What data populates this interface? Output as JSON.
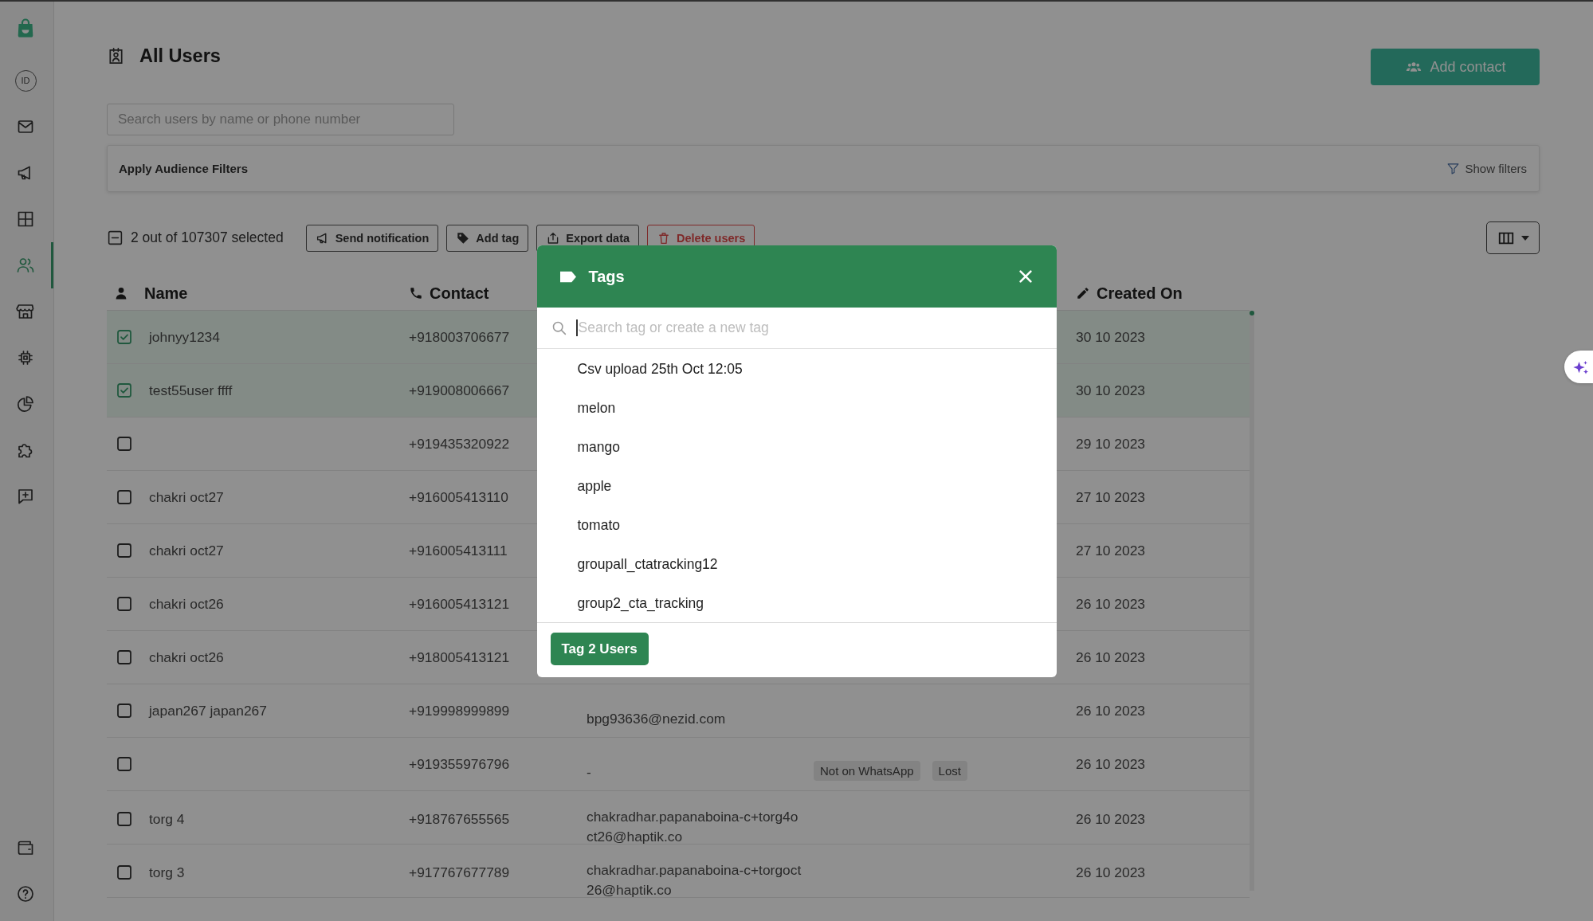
{
  "sidebar": {
    "items": [
      {
        "label": "ID",
        "selected": false
      },
      {
        "selected": false
      },
      {
        "selected": false
      },
      {
        "selected": false
      },
      {
        "selected": true
      },
      {
        "selected": false
      },
      {
        "selected": false
      },
      {
        "selected": false
      },
      {
        "selected": false
      },
      {
        "selected": false
      }
    ],
    "bottom_items": [
      {
        "selected": false
      },
      {
        "selected": false
      }
    ]
  },
  "header": {
    "title": "All Users",
    "add_button": "Add contact"
  },
  "search": {
    "placeholder": "Search users by name or phone number"
  },
  "filters": {
    "label": "Apply Audience Filters",
    "toggle": "Show filters"
  },
  "toolbar": {
    "select_all": {
      "indeterminate": true
    },
    "selection": "2 out of 107307 selected",
    "actions": [
      {
        "label": "Send notification",
        "kind": "default"
      },
      {
        "label": "Add tag",
        "kind": "default"
      },
      {
        "label": "Export data",
        "kind": "default"
      },
      {
        "label": "Delete users",
        "kind": "danger"
      }
    ]
  },
  "table": {
    "columns": [
      {
        "label": "Name"
      },
      {
        "label": "Contact"
      },
      {
        "label": "Created On"
      }
    ],
    "rows": [
      {
        "selected": true,
        "name": "johnyy1234",
        "contact": "+918003706677",
        "created": "30 10 2023"
      },
      {
        "selected": true,
        "name": "test55user ffff",
        "contact": "+919008006667",
        "created": "30 10 2023"
      },
      {
        "selected": false,
        "contact": "+919435320922",
        "created": "29 10 2023"
      },
      {
        "selected": false,
        "name": "chakri oct27",
        "contact": "+916005413110",
        "created": "27 10 2023"
      },
      {
        "selected": false,
        "name": "chakri oct27",
        "contact": "+916005413111",
        "created": "27 10 2023"
      },
      {
        "selected": false,
        "name": "chakri oct26",
        "contact": "+916005413121",
        "created": "26 10 2023"
      },
      {
        "selected": false,
        "name": "chakri oct26",
        "contact": "+918005413121",
        "created": "26 10 2023"
      },
      {
        "selected": false,
        "name": "japan267 japan267",
        "contact": "+919998999899",
        "email": "bpg93636@nezid.com",
        "created": "26 10 2023"
      },
      {
        "selected": false,
        "contact": "+919355976796",
        "email": "-",
        "tags": [
          "Not on WhatsApp",
          "Lost"
        ],
        "created": "26 10 2023"
      },
      {
        "selected": false,
        "name": "torg 4",
        "contact": "+918767655565",
        "email": "chakradhar.papanaboina-c+torg4oct26@haptik.co",
        "created": "26 10 2023"
      },
      {
        "selected": false,
        "name": "torg 3",
        "contact": "+917767677789",
        "email": "chakradhar.papanaboina-c+torgoct26@haptik.co",
        "created": "26 10 2023"
      }
    ]
  },
  "tags_dialog": {
    "title": "Tags",
    "search": {
      "placeholder": "Search tag or create a new tag"
    },
    "tags": [
      {
        "label": "Csv upload 25th Oct 12:05",
        "selected": false
      },
      {
        "label": "melon",
        "selected": false
      },
      {
        "label": "mango",
        "selected": false
      },
      {
        "label": "apple",
        "selected": false
      },
      {
        "label": "tomato",
        "selected": false
      },
      {
        "label": "groupall_ctatracking12",
        "selected": false
      },
      {
        "label": "group2_cta_tracking",
        "selected": false
      }
    ],
    "submit": "Tag 2 Users"
  }
}
